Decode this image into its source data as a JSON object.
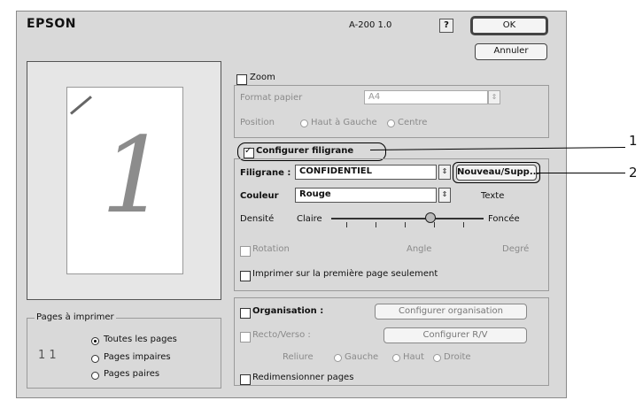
{
  "header": {
    "brand": "EPSON",
    "version": "A-200 1.0",
    "help_label": "?",
    "ok_label": "OK",
    "cancel_label": "Annuler"
  },
  "preview": {
    "page_number": "1"
  },
  "pages_group": {
    "title": "Pages à imprimer",
    "options": [
      "Toutes les pages",
      "Pages impaires",
      "Pages paires"
    ],
    "selected": "Toutes les pages",
    "thumbnail": "1 1"
  },
  "zoom": {
    "label": "Zoom",
    "paper_format_label": "Format papier",
    "paper_format_value": "A4",
    "position_label": "Position",
    "position_options": [
      "Haut à Gauche",
      "Centre"
    ]
  },
  "watermark": {
    "checkbox_label": "Configurer filigrane",
    "filigrane_label": "Filigrane :",
    "filigrane_value": "CONFIDENTIEL",
    "new_button": "Nouveau/Supp...",
    "color_label": "Couleur",
    "color_value": "Rouge",
    "text_button": "Texte",
    "density_label": "Densité",
    "density_low": "Claire",
    "density_high": "Foncée",
    "density_level": 0.65,
    "rotation_label": "Rotation",
    "angle_label": "Angle",
    "degree_label": "Degré",
    "first_page_only": "Imprimer sur la première page seulement"
  },
  "options": {
    "organize_label": "Organisation :",
    "organize_button": "Configurer organisation",
    "duplex_label": "Recto/Verso :",
    "duplex_button": "Configurer R/V",
    "binding_label": "Reliure",
    "binding_options": [
      "Gauche",
      "Haut",
      "Droite"
    ],
    "fit_label": "Redimensionner pages"
  },
  "callouts": {
    "one": "1",
    "two": "2"
  }
}
